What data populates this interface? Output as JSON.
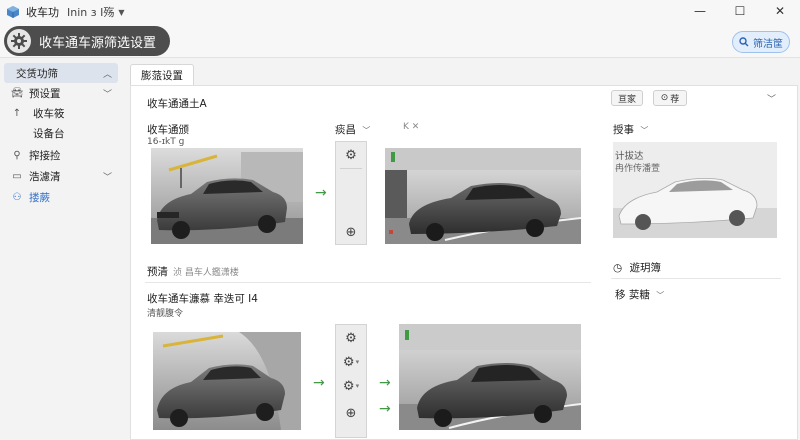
{
  "window": {
    "app_title": "收车功",
    "app_subtitle": "Inin ɜ I殇",
    "controls": [
      "—",
      "☐",
      "✕"
    ]
  },
  "header": {
    "title": "收车通车源筛选设置",
    "button_label": "筛洁筐"
  },
  "sidebar": {
    "items": [
      {
        "label": "交赁功筛",
        "icon": "",
        "expandable": true
      },
      {
        "label": "预设置",
        "icon": "car-icon",
        "expandable": true
      },
      {
        "label": "收车筱",
        "icon": "pin-icon",
        "expandable": false
      },
      {
        "label": "设备台",
        "icon": "",
        "expandable": false
      },
      {
        "label": "搾接捡",
        "icon": "location-icon",
        "expandable": false
      },
      {
        "label": "浩濾清",
        "icon": "folder-icon",
        "expandable": true
      },
      {
        "label": "搂蕨",
        "icon": "group-icon",
        "expandable": false
      }
    ]
  },
  "main": {
    "tab_label": "膨蒎设置",
    "section1": {
      "title": "收车通通土A",
      "item_title": "收车通颁",
      "item_value": "16-ɪkT g",
      "dropdown_label": "痰昌",
      "toolbar_extra": "K  ✕",
      "note_label": "预清",
      "note_text": "浈  昌车人鑑潇楼"
    },
    "section2": {
      "title": "收车通车濂慕 幸迭可 I4",
      "subtitle": "清靓腹令"
    },
    "right": {
      "btn1": "亘家",
      "btn2": "荐",
      "heading": "授事",
      "card_line1": "计拔达",
      "card_line2": "冉作传潘萱",
      "link1": "遊玥簿",
      "link2": "移 荬糖"
    }
  },
  "colors": {
    "accent": "#2f6fc7",
    "header_pill": "#4d4d4d",
    "arrow": "#3f9a43"
  }
}
